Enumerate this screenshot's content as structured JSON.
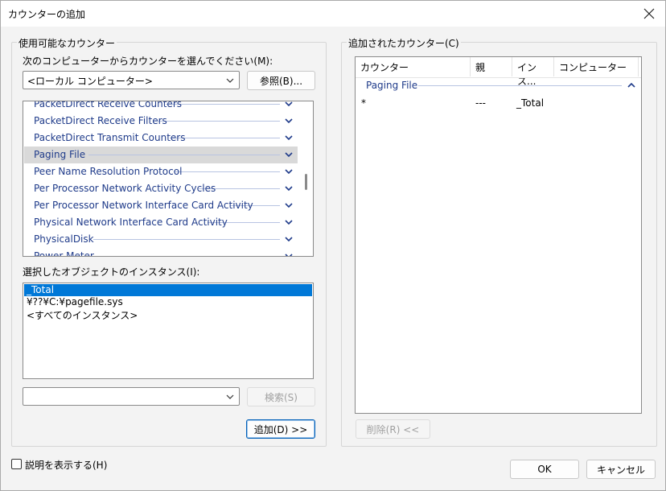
{
  "window": {
    "title": "カウンターの追加"
  },
  "available": {
    "group_label": "使用可能なカウンター",
    "computer_label": "次のコンピューターからカウンターを選んでください(M):",
    "computer_value": "<ローカル コンピューター>",
    "browse_label": "参照(B)...",
    "objects": [
      {
        "name": "PacketDirect Receive Counters",
        "selected": false
      },
      {
        "name": "PacketDirect Receive Filters",
        "selected": false
      },
      {
        "name": "PacketDirect Transmit Counters",
        "selected": false
      },
      {
        "name": "Paging File",
        "selected": true
      },
      {
        "name": "Peer Name Resolution Protocol",
        "selected": false
      },
      {
        "name": "Per Processor Network Activity Cycles",
        "selected": false
      },
      {
        "name": "Per Processor Network Interface Card Activity",
        "selected": false
      },
      {
        "name": "Physical Network Interface Card Activity",
        "selected": false
      },
      {
        "name": "PhysicalDisk",
        "selected": false
      },
      {
        "name": "Power Meter",
        "selected": false
      }
    ],
    "instances_label": "選択したオブジェクトのインスタンス(I):",
    "instances": [
      {
        "name": "_Total",
        "selected": true
      },
      {
        "name": "¥??¥C:¥pagefile.sys",
        "selected": false
      },
      {
        "name": "<すべてのインスタンス>",
        "selected": false
      }
    ],
    "search_value": "",
    "search_label": "検索(S)",
    "add_label": "追加(D) >>"
  },
  "added": {
    "group_label": "追加されたカウンター(C)",
    "columns": [
      "カウンター",
      "親",
      "インス...",
      "コンピューター"
    ],
    "group_name": "Paging File",
    "rows": [
      {
        "counter": "*",
        "parent": "---",
        "instance": "_Total",
        "computer": ""
      }
    ],
    "remove_label": "削除(R) <<"
  },
  "footer": {
    "show_description_label": "説明を表示する(H)",
    "show_description_checked": false,
    "ok_label": "OK",
    "cancel_label": "キャンセル"
  },
  "colors": {
    "accent": "#005fb8",
    "selection": "#0078d7",
    "object_text": "#1f3b8a",
    "selected_object_bg": "#d9d9d9"
  },
  "icons": {
    "close": "close-icon",
    "dropdown": "chevron-down-icon",
    "expand": "chevron-down-icon",
    "collapse": "chevron-up-icon"
  }
}
